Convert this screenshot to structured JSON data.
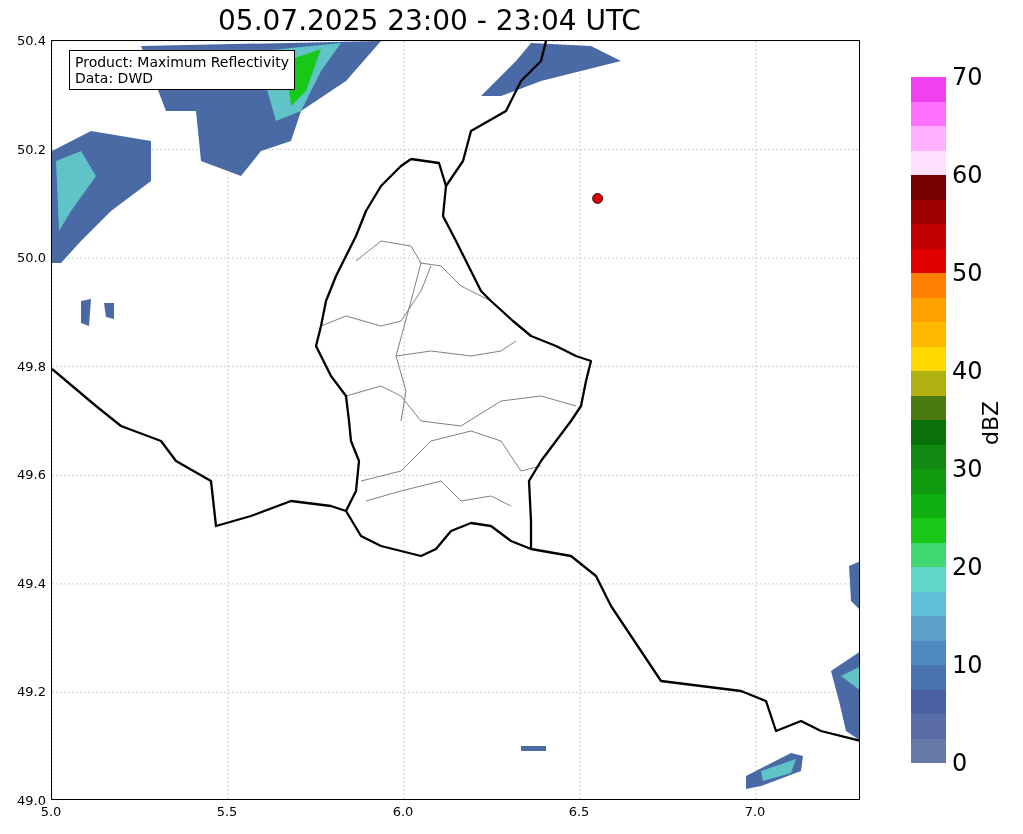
{
  "title": "05.07.2025 23:00 - 23:04 UTC",
  "legend": [
    "Product: Maximum Reflectivity",
    "Data: DWD"
  ],
  "x_ticks": [
    "5.0",
    "5.5",
    "6.0",
    "6.5",
    "7.0"
  ],
  "y_ticks": [
    "50.4",
    "50.2",
    "50.0",
    "49.8",
    "49.6",
    "49.4",
    "49.2",
    "49.0"
  ],
  "colorbar": {
    "label": "dBZ",
    "ticks": [
      "70",
      "60",
      "50",
      "40",
      "30",
      "20",
      "10",
      "0"
    ],
    "bands": [
      {
        "color": "#6878a8"
      },
      {
        "color": "#5a6ca5"
      },
      {
        "color": "#4a60a0"
      },
      {
        "color": "#4a72b0"
      },
      {
        "color": "#5088c0"
      },
      {
        "color": "#5ba0c8"
      },
      {
        "color": "#60c0d8"
      },
      {
        "color": "#60d8c8"
      },
      {
        "color": "#40d870"
      },
      {
        "color": "#18c818"
      },
      {
        "color": "#10b010"
      },
      {
        "color": "#109a10"
      },
      {
        "color": "#108a10"
      },
      {
        "color": "#0a700a"
      },
      {
        "color": "#4a7a10"
      },
      {
        "color": "#b0b010"
      },
      {
        "color": "#ffd800"
      },
      {
        "color": "#ffb800"
      },
      {
        "color": "#ffa000"
      },
      {
        "color": "#ff8000"
      },
      {
        "color": "#e00000"
      },
      {
        "color": "#c00000"
      },
      {
        "color": "#a00000"
      },
      {
        "color": "#780000"
      },
      {
        "color": "#ffe0ff"
      },
      {
        "color": "#ffb0ff"
      },
      {
        "color": "#ff70ff"
      },
      {
        "color": "#f040f0"
      }
    ]
  }
}
